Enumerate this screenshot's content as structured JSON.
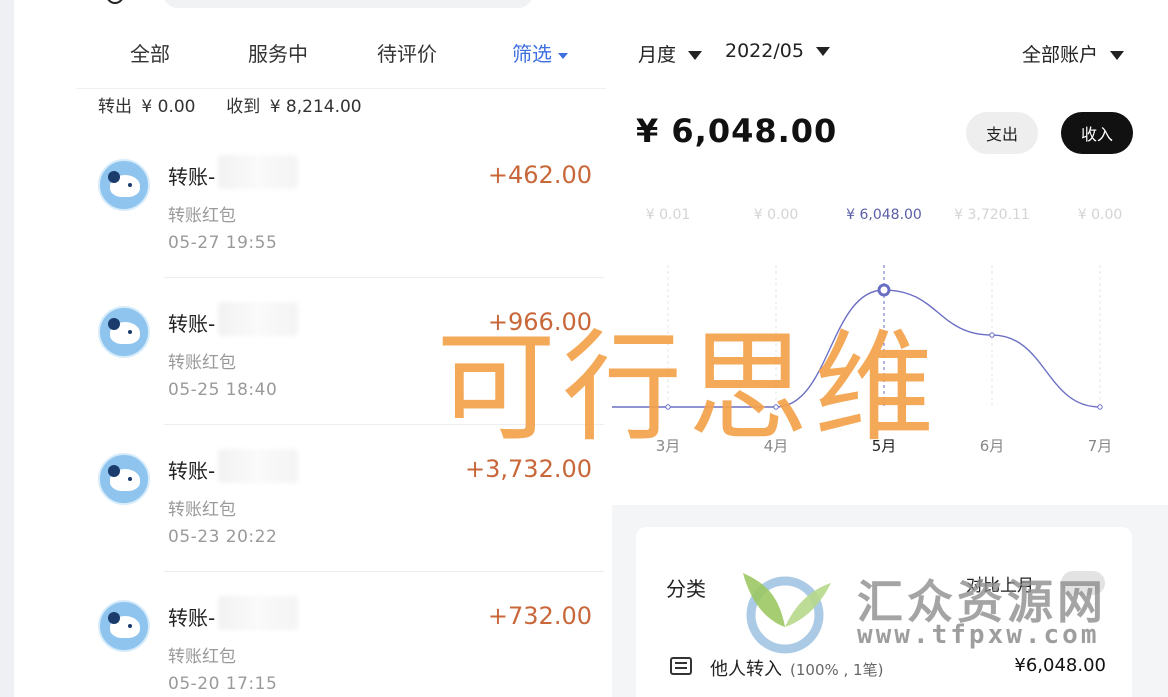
{
  "left": {
    "tabs": [
      {
        "label": "全部"
      },
      {
        "label": "服务中"
      },
      {
        "label": "待评价"
      },
      {
        "label": "筛选"
      }
    ],
    "summary": {
      "out_label": "转出",
      "out_value": "¥ 0.00",
      "in_label": "收到",
      "in_value": "¥ 8,214.00"
    },
    "transactions": [
      {
        "name": "转账-",
        "type": "转账红包",
        "time": "05-27  19:55",
        "amount": "+462.00"
      },
      {
        "name": "转账-",
        "type": "转账红包",
        "time": "05-25  18:40",
        "amount": "+966.00"
      },
      {
        "name": "转账-",
        "type": "转账红包",
        "time": "05-23  20:22",
        "amount": "+3,732.00"
      },
      {
        "name": "转账-",
        "type": "转账红包",
        "time": "05-20  17:15",
        "amount": "+732.00"
      }
    ]
  },
  "right": {
    "period_label": "月度",
    "month_label": "2022/05",
    "account_label": "全部账户",
    "total": "¥ 6,048.00",
    "expense_button": "支出",
    "income_button": "收入",
    "category_title": "分类",
    "compare_label": "对比上月",
    "category_row": {
      "label": "他人转入",
      "pct": "(100% , 1笔)",
      "amount": "¥6,048.00"
    }
  },
  "chart_data": {
    "type": "line",
    "categories": [
      "3月",
      "4月",
      "5月",
      "6月",
      "7月"
    ],
    "values": [
      0.01,
      0.0,
      6048.0,
      3720.11,
      0.0
    ],
    "value_labels": [
      "¥ 0.01",
      "¥ 0.00",
      "¥ 6,048.00",
      "¥ 3,720.11",
      "¥ 0.00"
    ],
    "selected_index": 2,
    "ylim": [
      0,
      6048
    ],
    "line_color": "#6b6fc4"
  },
  "watermarks": {
    "big_text": "可行思维",
    "brand": "汇众资源网",
    "url": "www.tfpxw.com"
  },
  "colors": {
    "accent": "#3d6fe0",
    "amount": "#c8683a",
    "watermark": "#f4a24c"
  }
}
